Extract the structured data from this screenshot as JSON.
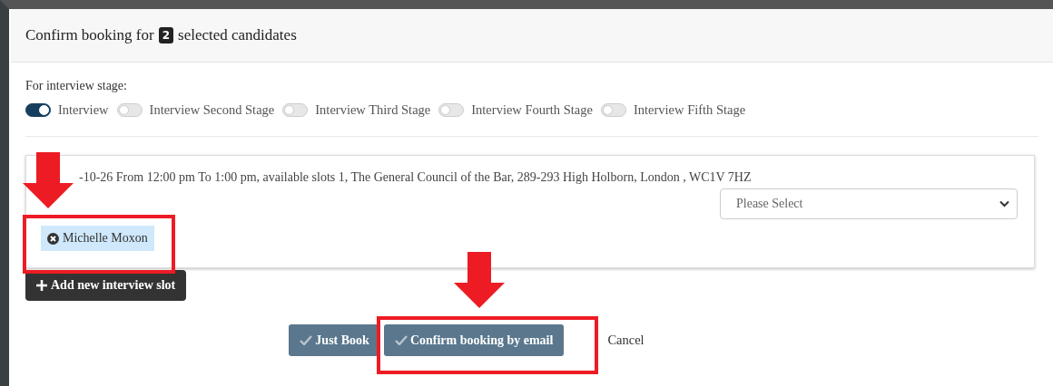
{
  "dialog": {
    "title_before": "Confirm booking for",
    "count": "2",
    "title_after": "selected candidates"
  },
  "stage_label": "For interview stage:",
  "stages": [
    {
      "label": "Interview",
      "on": true
    },
    {
      "label": "Interview Second Stage",
      "on": false
    },
    {
      "label": "Interview Third Stage",
      "on": false
    },
    {
      "label": "Interview Fourth Stage",
      "on": false
    },
    {
      "label": "Interview Fifth Stage",
      "on": false
    }
  ],
  "slot": {
    "text": "-10-26 From 12:00 pm To 1:00 pm, available slots 1, The General Council of the Bar, 289-293 High Holborn, London , WC1V 7HZ",
    "select_placeholder": "Please Select",
    "candidates": [
      "Michelle Moxon"
    ]
  },
  "add_slot_button": "Add new interview slot",
  "buttons": [
    {
      "label": "Just Book",
      "kind": "primary"
    },
    {
      "label": "Confirm booking by email",
      "kind": "primary"
    },
    {
      "label": "Cancel",
      "kind": "link"
    }
  ]
}
